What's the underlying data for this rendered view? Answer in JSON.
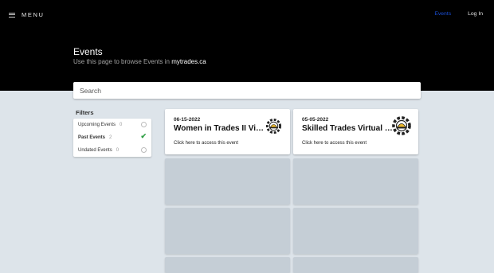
{
  "header": {
    "menu_label": "MENU",
    "nav": {
      "events_label": "Events",
      "login_label": "Log In"
    },
    "title": "Events",
    "subtitle_prefix": "Use this page to browse Events in ",
    "subtitle_site": "mytrades.ca"
  },
  "search": {
    "placeholder": "Search",
    "value": ""
  },
  "filters": {
    "title": "Filters",
    "items": [
      {
        "label": "Upcoming Events",
        "count": "0",
        "state": "unchecked"
      },
      {
        "label": "Past Events",
        "count": "2",
        "state": "checked"
      },
      {
        "label": "Undated Events",
        "count": "0",
        "state": "unchecked"
      }
    ]
  },
  "events": [
    {
      "date": "06-15-2022",
      "title": "Women in Trades II Virtual",
      "link_text": "Click here to access this event",
      "logo_icon": "gear-hardhat-logo"
    },
    {
      "date": "05-05-2022",
      "title": "Skilled Trades Virtual Fair",
      "link_text": "Click here to access this event",
      "logo_icon": "gear-hardhat-logo"
    }
  ],
  "colors": {
    "accent": "#1a4fd8",
    "header_bg": "#000000",
    "page_bg": "#dde4ea",
    "placeholder": "#c5ced6",
    "check": "#2e9e44"
  }
}
